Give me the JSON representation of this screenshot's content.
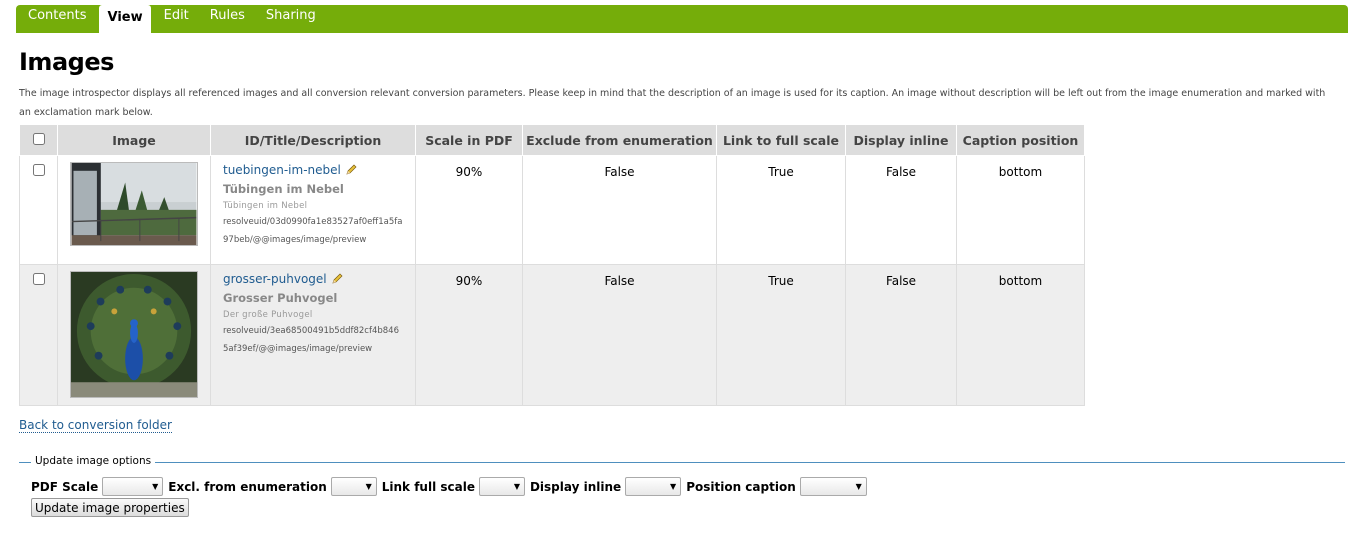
{
  "tabs": [
    {
      "label": "Contents",
      "active": false
    },
    {
      "label": "View",
      "active": true
    },
    {
      "label": "Edit",
      "active": false
    },
    {
      "label": "Rules",
      "active": false
    },
    {
      "label": "Sharing",
      "active": false
    }
  ],
  "page": {
    "title": "Images",
    "intro": "The image introspector displays all referenced images and all conversion relevant conversion parameters. Please keep in mind that the description of an image is used for its caption. An image without description will be left out from the image enumeration and marked with an exclamation mark below."
  },
  "table": {
    "headers": [
      "Image",
      "ID/Title/Description",
      "Scale in PDF",
      "Exclude from enumeration",
      "Link to full scale",
      "Display inline",
      "Caption position"
    ],
    "rows": [
      {
        "id": "tuebingen-im-nebel",
        "title": "Tübingen im Nebel",
        "description": "Tübingen im Nebel",
        "uid": "resolveuid/03d0990fa1e83527af0eff1a5fa97beb/@@images/image/preview",
        "scale": "90%",
        "exclude": "False",
        "link_full": "True",
        "inline": "False",
        "caption": "bottom"
      },
      {
        "id": "grosser-puhvogel",
        "title": "Grosser Puhvogel",
        "description": "Der große Puhvogel",
        "uid": "resolveuid/3ea68500491b5ddf82cf4b8465af39ef/@@images/image/preview",
        "scale": "90%",
        "exclude": "False",
        "link_full": "True",
        "inline": "False",
        "caption": "bottom"
      }
    ]
  },
  "back_link": "Back to conversion folder",
  "options": {
    "legend": "Update image options",
    "pdf_scale_label": "PDF Scale",
    "excl_label": "Excl. from enumeration",
    "link_full_label": "Link full scale",
    "display_inline_label": "Display inline",
    "position_caption_label": "Position caption",
    "button_label": "Update image properties"
  },
  "colors": {
    "tab_bar": "#75ad0a",
    "link": "#205c90",
    "header_bg": "#dddddd",
    "row_alt_bg": "#eeeeee"
  }
}
